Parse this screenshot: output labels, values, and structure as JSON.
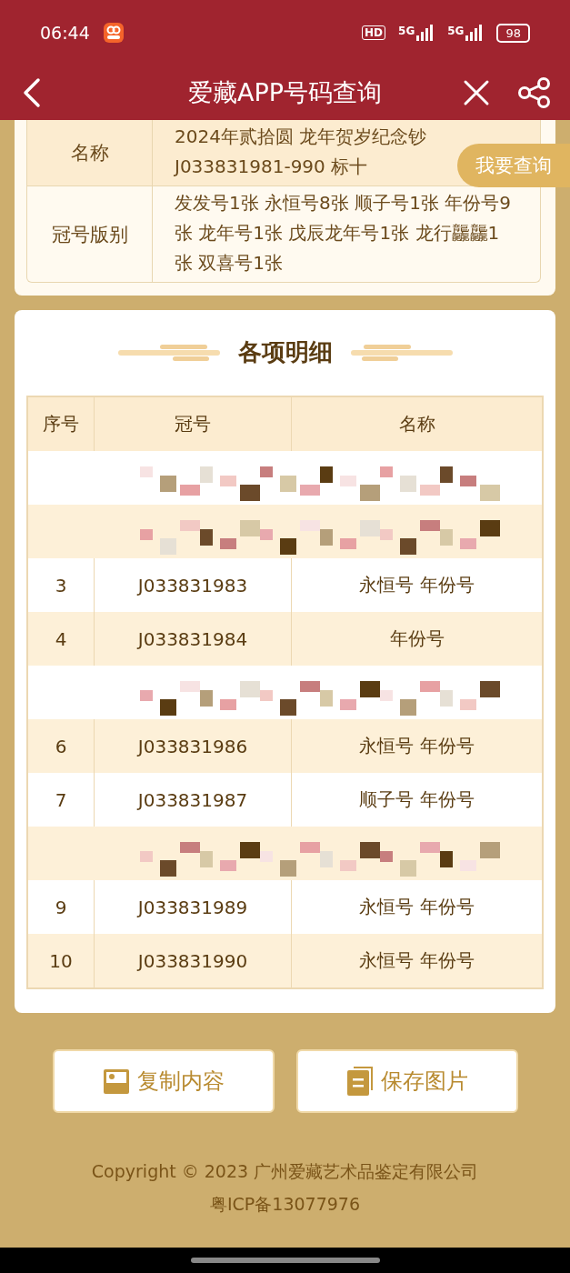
{
  "status_bar": {
    "time": "06:44",
    "indicators": [
      "HD",
      "5G",
      "5G"
    ],
    "battery": "98"
  },
  "nav": {
    "title": "爱藏APP号码查询"
  },
  "info_table": {
    "rows": [
      {
        "label": "名称",
        "value": "2024年贰拾圆 龙年贺岁纪念钞 J033831981-990 标十"
      },
      {
        "label": "冠号版别",
        "value": "发发号1张 永恒号8张 顺子号1张 年份号9张 龙年号1张 戊辰龙年号1张 龙行龘龘1张 双喜号1张"
      }
    ]
  },
  "query_button": "我要查询",
  "details": {
    "title": "各项明细",
    "columns": [
      "序号",
      "冠号",
      "名称"
    ],
    "rows": [
      {
        "kind": "redacted"
      },
      {
        "kind": "redacted"
      },
      {
        "kind": "normal",
        "index": "3",
        "serial": "J033831983",
        "name": "永恒号 年份号"
      },
      {
        "kind": "normal",
        "index": "4",
        "serial": "J033831984",
        "name": "年份号"
      },
      {
        "kind": "redacted"
      },
      {
        "kind": "normal",
        "index": "6",
        "serial": "J033831986",
        "name": "永恒号 年份号"
      },
      {
        "kind": "normal",
        "index": "7",
        "serial": "J033831987",
        "name": "顺子号 年份号"
      },
      {
        "kind": "redacted"
      },
      {
        "kind": "normal",
        "index": "9",
        "serial": "J033831989",
        "name": "永恒号 年份号"
      },
      {
        "kind": "normal",
        "index": "10",
        "serial": "J033831990",
        "name": "永恒号 年份号"
      }
    ]
  },
  "buttons": [
    {
      "kind": "copy",
      "label": "复制内容"
    },
    {
      "kind": "save",
      "label": "保存图片"
    }
  ],
  "footer": [
    "Copyright © 2023 广州爱藏艺术品鉴定有限公司",
    "粤ICP备13077976"
  ]
}
